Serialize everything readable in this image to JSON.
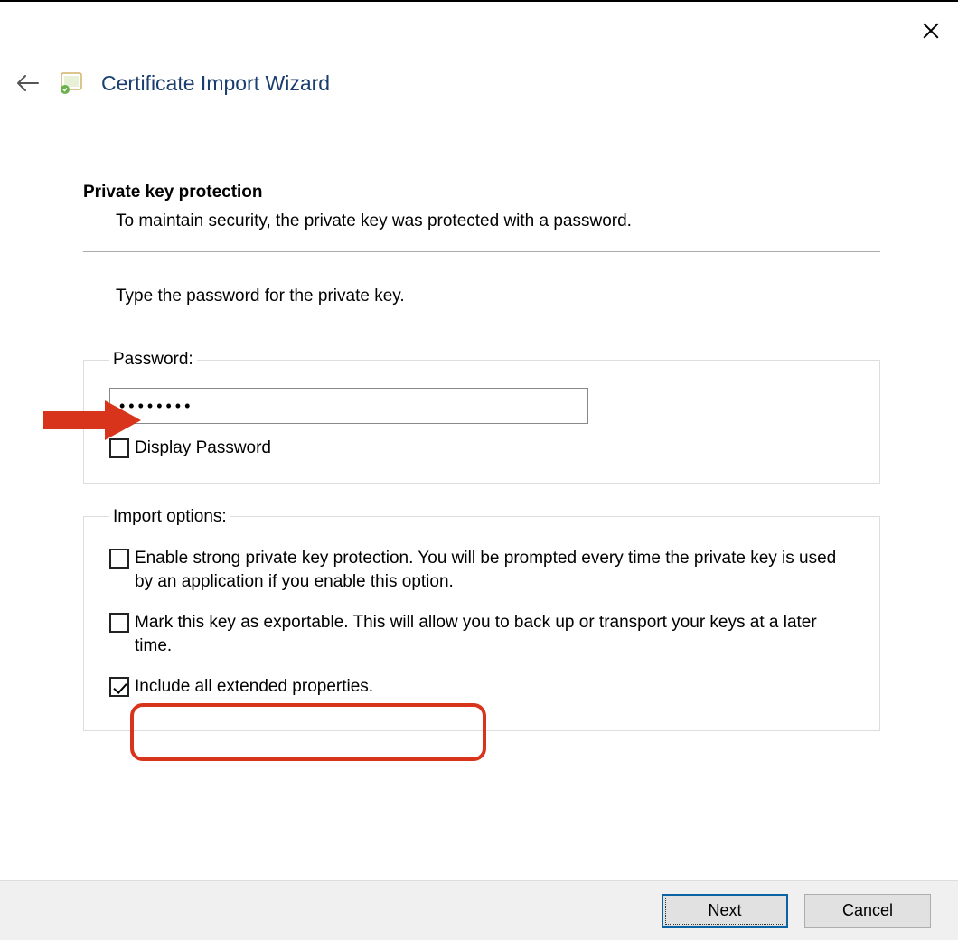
{
  "header": {
    "title": "Certificate Import Wizard"
  },
  "section": {
    "heading": "Private key protection",
    "description": "To maintain security, the private key was protected with a password.",
    "prompt": "Type the password for the private key."
  },
  "password_group": {
    "legend": "Password:",
    "value": "••••••••",
    "display_password_label": "Display Password",
    "display_password_checked": false
  },
  "import_options": {
    "legend": "Import options:",
    "items": [
      {
        "label": "Enable strong private key protection. You will be prompted every time the private key is used by an application if you enable this option.",
        "checked": false
      },
      {
        "label": "Mark this key as exportable. This will allow you to back up or transport your keys at a later time.",
        "checked": false
      },
      {
        "label": "Include all extended properties.",
        "checked": true
      }
    ]
  },
  "footer": {
    "next_label": "Next",
    "cancel_label": "Cancel"
  }
}
